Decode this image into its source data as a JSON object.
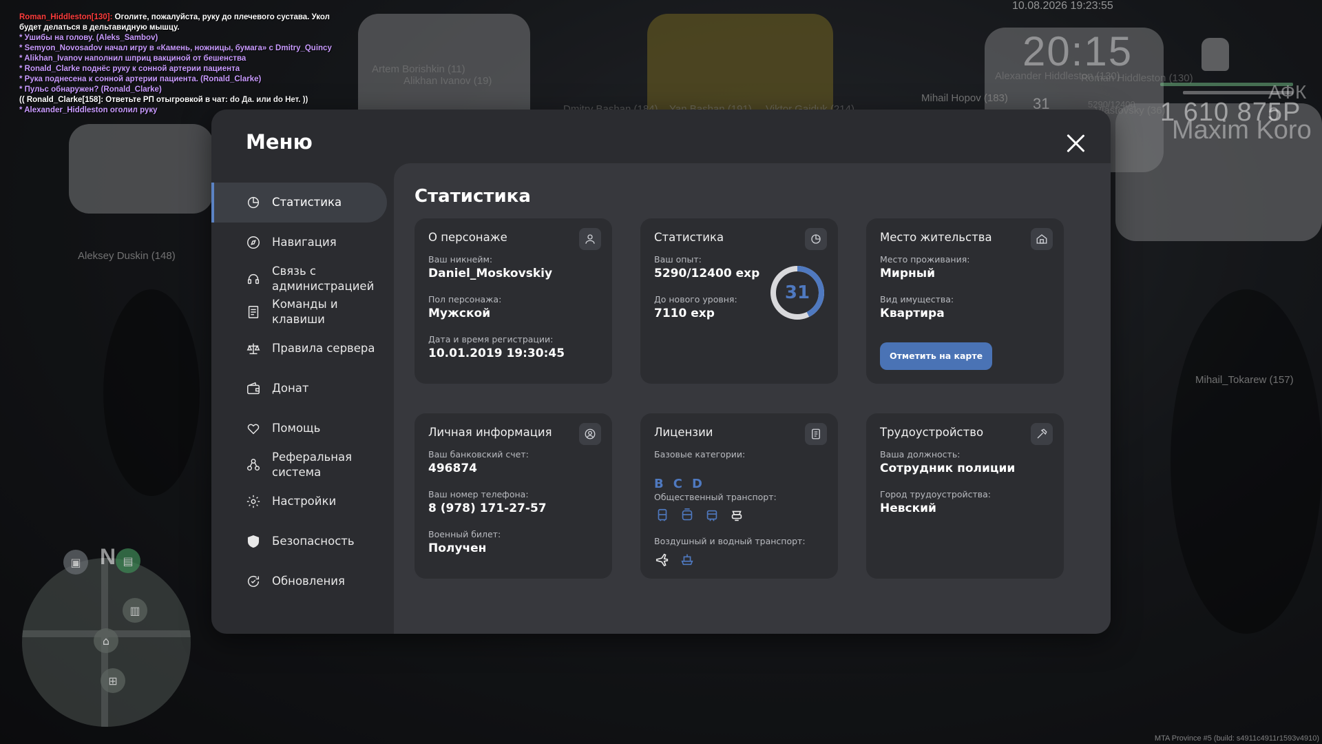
{
  "chat": [
    {
      "name": "Roman_Hiddleston[130]:",
      "text": " Оголите, пожалуйста, руку до плечевого сустава. Укол",
      "color": "white"
    },
    {
      "name": "",
      "text": "будет делаться в дельтавидную мышцу.",
      "color": "white"
    },
    {
      "name": "",
      "text": "* Ушибы на голову. (Aleks_Sambov)",
      "color": "purple"
    },
    {
      "name": "",
      "text": "* Semyon_Novosadov начал игру в «Камень, ножницы, бумага» с Dmitry_Quincy",
      "color": "purple"
    },
    {
      "name": "",
      "text": "* Alikhan_Ivanov наполнил шприц вакциной от бешенства",
      "color": "purple"
    },
    {
      "name": "",
      "text": "* Ronald_Clarke поднёс руку к сонной артерии пациента",
      "color": "purple"
    },
    {
      "name": "",
      "text": "* Рука поднесена к сонной артерии пациента. (Ronald_Clarke)",
      "color": "purple"
    },
    {
      "name": "",
      "text": "* Пульс обнаружен? (Ronald_Clarke)",
      "color": "purple"
    },
    {
      "name": "",
      "text": "(( Ronald_Clarke[158]: Ответьте РП отыгровкой в чат: do Да. или do Нет. ))",
      "color": "white"
    },
    {
      "name": "",
      "text": "* Alexander_Hiddleston оголил руку",
      "color": "purple"
    }
  ],
  "hud": {
    "datetime": "10.08.2026 19:23:55",
    "time": "20:15",
    "level": "31",
    "afk": "АФК 0",
    "money": "1 610 875Р",
    "player_name": "Maxim Koro",
    "build": "MTA Province #5 (build: s4911c4911r1593v4910)"
  },
  "nametags": {
    "t1": "Artem Borishkin (11)",
    "t2": "Alikhan Ivanov (19)",
    "t3": "Alexander Hiddleston (130)",
    "t4": "Roman Hiddleston (130)",
    "t5": "Mihail Hopov (183)",
    "t6": "Aleksey Duskin (148)",
    "t7": "Mihail_Tokarew (157)",
    "t8": "Dmitry Bashan (184)",
    "t9": "Yan Bashan (191)",
    "t10": "Viktor Gaiduk (214)",
    "t11": "Vlastovsky (36)",
    "t12": "5290/12400"
  },
  "menu": {
    "title": "Меню",
    "nav": [
      {
        "label": "Статистика",
        "icon": "pie-chart-icon",
        "active": true
      },
      {
        "label": "Навигация",
        "icon": "compass-icon"
      },
      {
        "label": "Связь с администрацией",
        "icon": "headset-icon"
      },
      {
        "label": "Команды и клавиши",
        "icon": "document-icon"
      },
      {
        "label": "Правила сервера",
        "icon": "scales-icon"
      },
      {
        "label": "Донат",
        "icon": "wallet-icon"
      },
      {
        "label": "Помощь",
        "icon": "heart-hands-icon"
      },
      {
        "label": "Реферальная система",
        "icon": "referral-icon"
      },
      {
        "label": "Настройки",
        "icon": "gear-icon"
      },
      {
        "label": "Безопасность",
        "icon": "shield-icon"
      },
      {
        "label": "Обновления",
        "icon": "refresh-check-icon"
      }
    ]
  },
  "stats": {
    "title": "Статистика",
    "character": {
      "title": "О персонаже",
      "nickname_label": "Ваш никнейм:",
      "nickname": "Daniel_Moskovskiy",
      "gender_label": "Пол персонажа:",
      "gender": "Мужской",
      "reg_label": "Дата и время регистрации:",
      "reg_date": "10.01.2019 19:30:45"
    },
    "statistics": {
      "title": "Статистика",
      "exp_label": "Ваш опыт:",
      "exp": "5290/12400 exp",
      "next_label": "До нового уровня:",
      "next": "7110 exp",
      "level": "31",
      "progress": 0.4266
    },
    "residence": {
      "title": "Место жительства",
      "place_label": "Место проживания:",
      "place": "Мирный",
      "type_label": "Вид имущества:",
      "type": "Квартира",
      "button": "Отметить на карте"
    },
    "personal": {
      "title": "Личная информация",
      "bank_label": "Ваш банковский счет:",
      "bank": "496874",
      "phone_label": "Ваш номер телефона:",
      "phone": "8 (978) 171-27-57",
      "military_label": "Военный билет:",
      "military": "Получен"
    },
    "licenses": {
      "title": "Лицензии",
      "base_label": "Базовые категории:",
      "categories": [
        "B",
        "C",
        "D"
      ],
      "public_label": "Общественный транспорт:",
      "air_label": "Воздушный и водный транспорт:"
    },
    "employment": {
      "title": "Трудоустройство",
      "position_label": "Ваша должность:",
      "position": "Сотрудник полиции",
      "city_label": "Город трудоустройства:",
      "city": "Невский"
    }
  },
  "colors": {
    "accent": "#4f79c0",
    "button": "#4a73b5",
    "panel": "#2b2c30",
    "content": "#37383d",
    "card": "#2c2d31"
  }
}
